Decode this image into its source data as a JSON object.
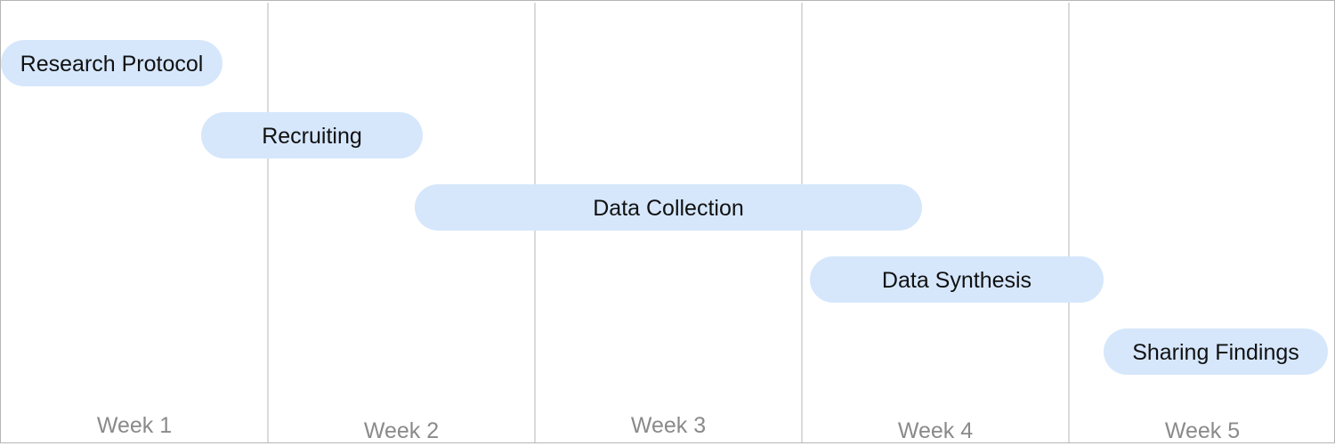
{
  "chart_data": {
    "type": "gantt",
    "title": "",
    "xlabel": "",
    "ylabel": "",
    "x_unit": "week",
    "xlim": [
      1,
      6
    ],
    "grid": "vertical week dividers",
    "categories": [
      "Week 1",
      "Week 2",
      "Week 3",
      "Week 4",
      "Week 5"
    ],
    "tasks": [
      {
        "label": "Research Protocol",
        "start": 1.0,
        "end": 1.83
      },
      {
        "label": "Recruiting",
        "start": 1.75,
        "end": 2.58
      },
      {
        "label": "Data Collection",
        "start": 2.55,
        "end": 4.45
      },
      {
        "label": "Data Synthesis",
        "start": 4.03,
        "end": 5.13
      },
      {
        "label": "Sharing Findings",
        "start": 5.13,
        "end": 5.97
      }
    ]
  },
  "colors": {
    "bar_fill": "#d6e7fc",
    "divider": "#b5b5b5",
    "week_text": "#8a8a8a",
    "task_text": "#111111"
  }
}
